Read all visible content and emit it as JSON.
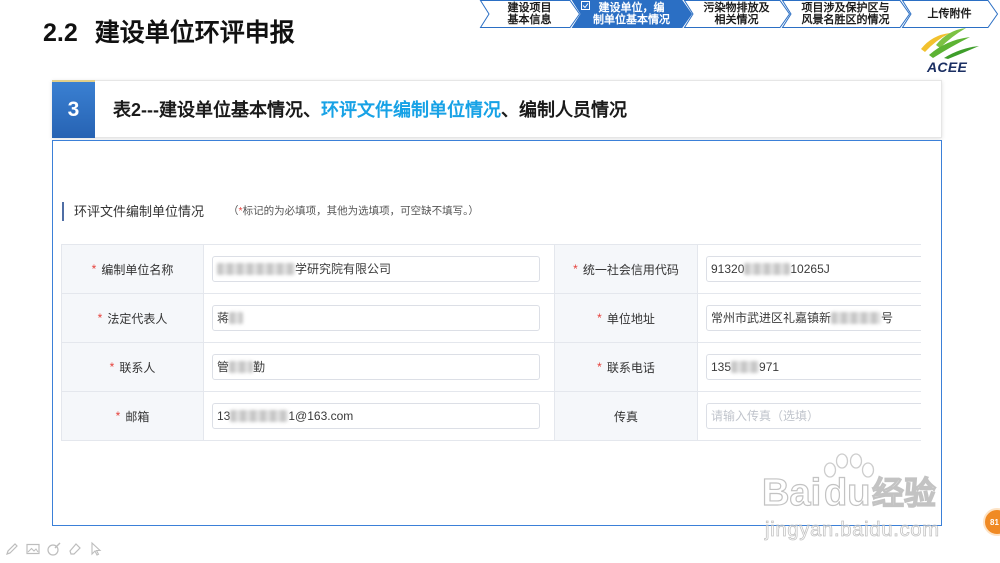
{
  "colors": {
    "accent": "#2b6fc4",
    "highlight": "#17a2e6",
    "required": "#e5403a",
    "form_border": "#3b80d8"
  },
  "page": {
    "number": "2.2",
    "title": "建设单位环评申报"
  },
  "steps": [
    {
      "line1": "建设项目",
      "line2": "基本信息",
      "active": false
    },
    {
      "icon": "form-icon",
      "line1": "建设单位，编",
      "line2": "制单位基本情况",
      "active": true
    },
    {
      "line1": "污染物排放及",
      "line2": "相关情况",
      "active": false
    },
    {
      "line1": "项目涉及保护区与",
      "line2": "风景名胜区的情况",
      "active": false
    },
    {
      "line1": "上传附件",
      "active": false
    }
  ],
  "logo": {
    "icon": "leaf-logo-icon",
    "text": "ACEE"
  },
  "section": {
    "number": "3",
    "title_before": "表2---建设单位基本情况、",
    "title_highlight": "环评文件编制单位情况",
    "title_after": "、编制人员情况"
  },
  "form": {
    "heading": "环评文件编制单位情况",
    "note_open": "（",
    "note_text": "标记的为必填项，其他为选填项，可空缺不填写。）",
    "required_mark": "*",
    "rows": [
      {
        "left": {
          "label": "编制单位名称",
          "required": true,
          "value_end": "学研究院有限公司"
        },
        "right": {
          "label": "统一社会信用代码",
          "required": true,
          "value_start": "91320",
          "value_end": "10265J"
        }
      },
      {
        "left": {
          "label": "法定代表人",
          "required": true,
          "value_start": "蒋"
        },
        "right": {
          "label": "单位地址",
          "required": true,
          "value_start": "常州市武进区礼嘉镇新",
          "value_end": "号"
        }
      },
      {
        "left": {
          "label": "联系人",
          "required": true,
          "value_start": "管",
          "value_end": "勤"
        },
        "right": {
          "label": "联系电话",
          "required": true,
          "value_start": "135",
          "value_end": "971"
        }
      },
      {
        "left": {
          "label": "邮箱",
          "required": true,
          "value_start": "13",
          "value_end": "1@163.com"
        },
        "right": {
          "label": "传真",
          "required": false,
          "placeholder": "请输入传真（选填）"
        }
      }
    ]
  },
  "toolbar": {
    "icons": [
      "pen-icon",
      "image-icon",
      "highlighter-icon",
      "eraser-icon",
      "cursor-icon"
    ]
  },
  "watermark": {
    "icon": "paw-icon",
    "latin_1": "Bai",
    "latin_2": "du",
    "chinese": "经验",
    "domain": "jingyan.baidu.com"
  },
  "badge": {
    "text": "81"
  }
}
